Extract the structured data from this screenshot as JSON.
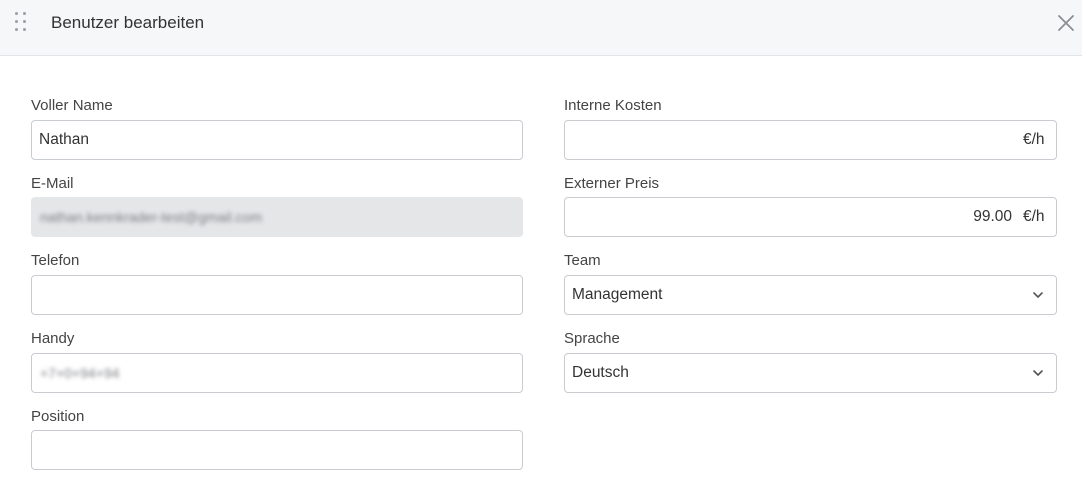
{
  "dialog": {
    "title": "Benutzer bearbeiten"
  },
  "fields": {
    "full_name": {
      "label": "Voller Name",
      "value": "Nathan"
    },
    "email": {
      "label": "E-Mail",
      "value": "nathan.kennkrader-test@gmail.com"
    },
    "phone": {
      "label": "Telefon",
      "value": ""
    },
    "mobile": {
      "label": "Handy",
      "value": "+7+0+94+94"
    },
    "position": {
      "label": "Position",
      "value": ""
    },
    "internal_cost": {
      "label": "Interne Kosten",
      "value": "",
      "suffix": "€/h"
    },
    "external_price": {
      "label": "Externer Preis",
      "value": "99.00",
      "suffix": "€/h"
    },
    "team": {
      "label": "Team",
      "value": "Management"
    },
    "language": {
      "label": "Sprache",
      "value": "Deutsch"
    }
  },
  "icons": {
    "drag": "drag-handle-icon",
    "close": "close-icon",
    "chevron": "chevron-down-icon"
  },
  "colors": {
    "header_bg": "#f6f7f9",
    "border": "#c9ccd1",
    "disabled_bg": "#e5e6e8"
  }
}
